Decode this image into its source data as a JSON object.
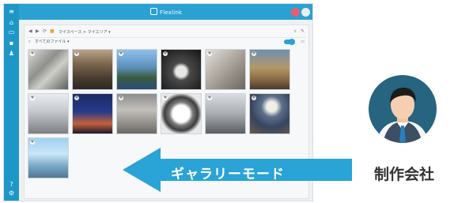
{
  "app": {
    "title": "Flexlink",
    "address_path": "マイスペース > マイエリア ▾",
    "filter_label": "すべてのファイル ▾"
  },
  "icons": {
    "sidebar": [
      "menu-icon",
      "home-icon",
      "folder-icon",
      "chat-icon",
      "user-icon",
      "help-icon",
      "settings-icon"
    ],
    "toolbar": [
      "back-icon",
      "forward-icon",
      "reload-icon",
      "folder-icon",
      "search-icon",
      "edit-icon",
      "toggle",
      "print-icon"
    ]
  },
  "gallery": {
    "items": [
      "photo-1",
      "photo-2",
      "photo-3",
      "photo-4",
      "photo-5",
      "photo-6",
      "photo-7",
      "photo-8",
      "photo-9",
      "photo-10",
      "photo-11",
      "photo-12",
      "photo-13"
    ]
  },
  "overlay": {
    "arrow_label": "ギャラリーモード",
    "role_label": "制作会社"
  },
  "colors": {
    "accent": "#2ba1d3",
    "sidebar": "#1e97c8",
    "arrow": "#2aa3d6",
    "avatar_bg": "#26647f"
  }
}
